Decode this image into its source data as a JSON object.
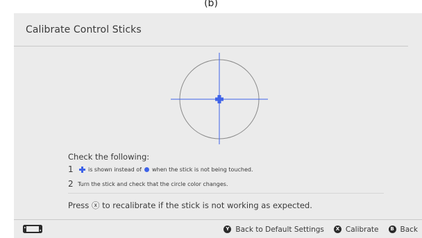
{
  "top_label": "(b)",
  "header": {
    "title": "Calibrate Control Sticks"
  },
  "colors": {
    "accent": "#3f63e8",
    "background": "#ebebeb",
    "text": "#3a3a3a",
    "badge": "#2b2b2b"
  },
  "checks": {
    "title": "Check the following:",
    "items": [
      {
        "num": "1",
        "icon_plus": "blue-plus-icon",
        "text_a": "is shown instead of",
        "icon_dot": "blue-dot-icon",
        "text_b": "when the stick is not being touched."
      },
      {
        "num": "2",
        "text": "Turn the stick and check that the circle color changes."
      }
    ]
  },
  "note": {
    "prefix": "Press",
    "symbol": "ⓧ",
    "suffix": "to recalibrate if the stick is not working as expected."
  },
  "footer": {
    "console_icon": "switch-console-icon",
    "actions": [
      {
        "badge": "Y",
        "label": "Back to Default Settings"
      },
      {
        "badge": "X",
        "label": "Calibrate"
      },
      {
        "badge": "B",
        "label": "Back"
      }
    ]
  }
}
